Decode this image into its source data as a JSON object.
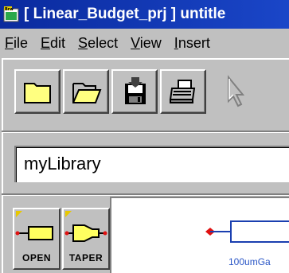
{
  "window": {
    "title": "[ Linear_Budget_prj ] untitle"
  },
  "menu": {
    "items": [
      {
        "accel": "F",
        "rest": "ile"
      },
      {
        "accel": "E",
        "rest": "dit"
      },
      {
        "accel": "S",
        "rest": "elect"
      },
      {
        "accel": "V",
        "rest": "iew"
      },
      {
        "accel": "I",
        "rest": "nsert"
      }
    ]
  },
  "toolbar": {
    "icons": [
      "new-file-icon",
      "open-folder-icon",
      "save-icon",
      "print-icon",
      "select-arrow-icon"
    ]
  },
  "library": {
    "value": "myLibrary"
  },
  "palette": {
    "items": [
      {
        "label": "OPEN",
        "icon": "open-component-icon"
      },
      {
        "label": "TAPER",
        "icon": "taper-component-icon"
      }
    ]
  },
  "canvas": {
    "component_label": "100umGa"
  },
  "colors": {
    "title_bar": "#0a2a9e",
    "chrome": "#c0c0c0",
    "component_outline": "#1a3fb0",
    "port_dot": "#e01010",
    "label_text": "#2a56c6"
  }
}
